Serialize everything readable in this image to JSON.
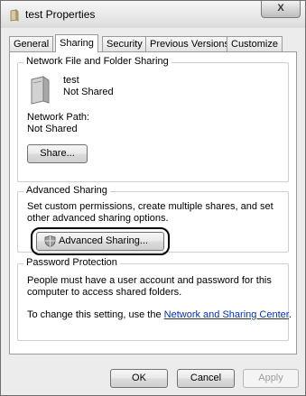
{
  "window": {
    "title": "test Properties",
    "close_label": "X"
  },
  "tabs": [
    {
      "label": "General",
      "active": false
    },
    {
      "label": "Sharing",
      "active": true
    },
    {
      "label": "Security",
      "active": false
    },
    {
      "label": "Previous Versions",
      "active": false
    },
    {
      "label": "Customize",
      "active": false
    }
  ],
  "network_sharing": {
    "group_label": "Network File and Folder Sharing",
    "folder_name": "test",
    "share_status": "Not Shared",
    "network_path_label": "Network Path:",
    "network_path_value": "Not Shared",
    "share_button": "Share..."
  },
  "advanced_sharing": {
    "group_label": "Advanced Sharing",
    "description": "Set custom permissions, create multiple shares, and set other advanced sharing options.",
    "button": "Advanced Sharing..."
  },
  "password_protection": {
    "group_label": "Password Protection",
    "description": "People must have a user account and password for this computer to access shared folders.",
    "change_prefix": "To change this setting, use the ",
    "link_text": "Network and Sharing Center",
    "change_suffix": "."
  },
  "footer": {
    "ok": "OK",
    "cancel": "Cancel",
    "apply": "Apply"
  }
}
